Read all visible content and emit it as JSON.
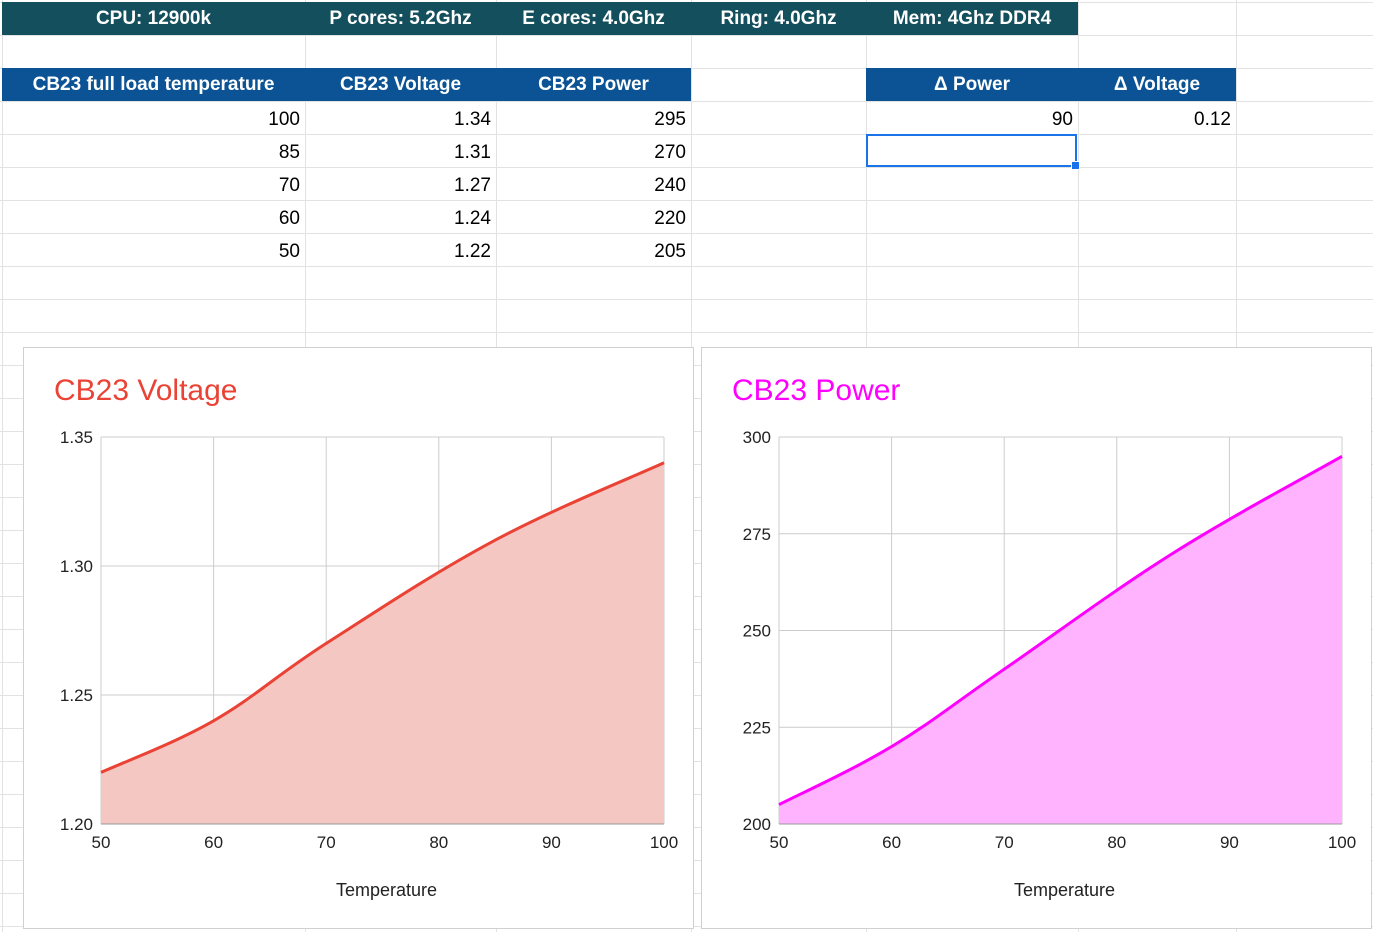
{
  "banner": [
    "CPU: 12900k",
    "P cores: 5.2Ghz",
    "E cores: 4.0Ghz",
    "Ring: 4.0Ghz",
    "Mem: 4Ghz DDR4"
  ],
  "table": {
    "headers": [
      "CB23 full load temperature",
      "CB23 Voltage",
      "CB23 Power"
    ],
    "rows": [
      [
        "100",
        "1.34",
        "295"
      ],
      [
        "85",
        "1.31",
        "270"
      ],
      [
        "70",
        "1.27",
        "240"
      ],
      [
        "60",
        "1.24",
        "220"
      ],
      [
        "50",
        "1.22",
        "205"
      ]
    ]
  },
  "delta": {
    "headers": [
      "Δ Power",
      "Δ Voltage"
    ],
    "values": [
      "90",
      "0.12"
    ]
  },
  "colors": {
    "banner_bg": "#134f5c",
    "header_bg": "#0b5394",
    "voltage_line": "#ea4335",
    "voltage_fill": "#f4c7c3",
    "power_line": "#ff00ff",
    "power_fill": "#ffb3ff"
  },
  "chart_data": [
    {
      "type": "area",
      "title": "CB23 Voltage",
      "xlabel": "Temperature",
      "ylabel": "",
      "x": [
        50,
        60,
        70,
        85,
        100
      ],
      "y": [
        1.22,
        1.24,
        1.27,
        1.31,
        1.34
      ],
      "xlim": [
        50,
        100
      ],
      "ylim": [
        1.2,
        1.35
      ],
      "xticks": [
        50,
        60,
        70,
        80,
        90,
        100
      ],
      "yticks": [
        "1.20",
        "1.25",
        "1.30",
        "1.35"
      ],
      "grid": true,
      "legend": "none",
      "color": "#ea4335"
    },
    {
      "type": "area",
      "title": "CB23 Power",
      "xlabel": "Temperature",
      "ylabel": "",
      "x": [
        50,
        60,
        70,
        85,
        100
      ],
      "y": [
        205,
        220,
        240,
        270,
        295
      ],
      "xlim": [
        50,
        100
      ],
      "ylim": [
        200,
        300
      ],
      "xticks": [
        50,
        60,
        70,
        80,
        90,
        100
      ],
      "yticks": [
        "200",
        "225",
        "250",
        "275",
        "300"
      ],
      "grid": true,
      "legend": "none",
      "color": "#ff00ff"
    }
  ]
}
